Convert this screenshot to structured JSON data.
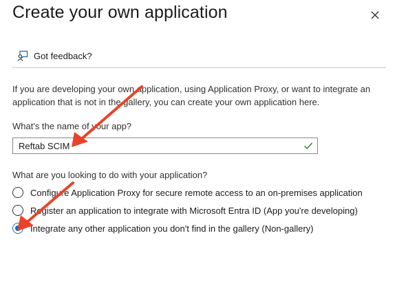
{
  "header": {
    "title": "Create your own application",
    "close_icon": "close-icon"
  },
  "toolbar": {
    "feedback_label": "Got feedback?",
    "feedback_icon": "feedback-icon"
  },
  "description": "If you are developing your own application, using Application Proxy, or want to integrate an application that is not in the gallery, you can create your own application here.",
  "name_field": {
    "label": "What's the name of your app?",
    "value": "Reftab SCIM",
    "valid_icon": "checkmark-icon"
  },
  "purpose": {
    "question": "What are you looking to do with your application?",
    "options": [
      {
        "label": "Configure Application Proxy for secure remote access to an on-premises application",
        "selected": false
      },
      {
        "label": "Register an application to integrate with Microsoft Entra ID (App you're developing)",
        "selected": false
      },
      {
        "label": "Integrate any other application you don't find in the gallery (Non-gallery)",
        "selected": true
      }
    ]
  },
  "colors": {
    "accent": "#0f6cbd",
    "valid_check": "#107c10",
    "annotation_arrow": "#e8432a"
  }
}
